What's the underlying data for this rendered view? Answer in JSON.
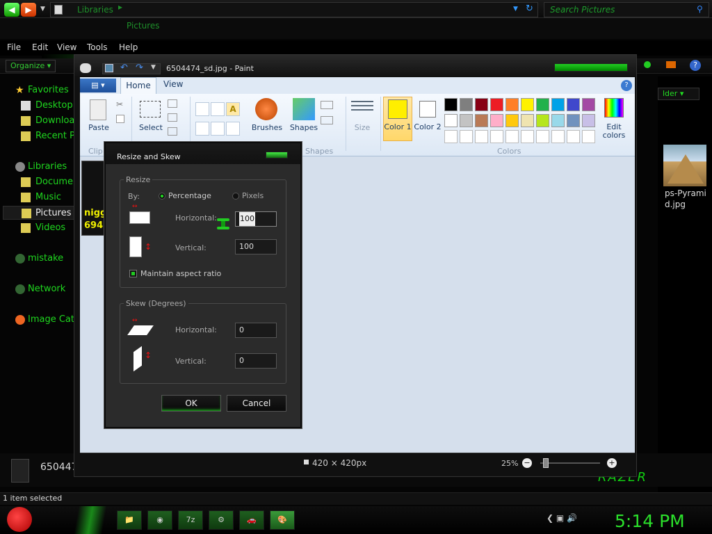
{
  "explorer": {
    "address": {
      "crumb1": "Libraries",
      "crumb2": "Pictures",
      "separator": "▸"
    },
    "search_placeholder": "Search Pictures",
    "menu": [
      "File",
      "Edit",
      "View",
      "Tools",
      "Help"
    ],
    "organize": "Organize ▾",
    "sidebar": [
      {
        "label": "Favorites",
        "icon": "star-icon"
      },
      {
        "label": "Desktop",
        "icon": "desktop-icon"
      },
      {
        "label": "Downloads",
        "icon": "folder-icon"
      },
      {
        "label": "Recent Places",
        "icon": "folder-icon"
      },
      {
        "label": "Libraries",
        "icon": "library-icon"
      },
      {
        "label": "Documents",
        "icon": "folder-icon"
      },
      {
        "label": "Music",
        "icon": "folder-icon"
      },
      {
        "label": "Pictures",
        "icon": "folder-icon"
      },
      {
        "label": "Videos",
        "icon": "folder-icon"
      },
      {
        "label": "mistake",
        "icon": "homegroup-icon"
      },
      {
        "label": "Network",
        "icon": "network-icon"
      },
      {
        "label": "Image Catalog",
        "icon": "catalog-icon"
      }
    ],
    "new_folder": "lder ▾",
    "right_file_label": "ps-Pyrami d.jpg",
    "bottom_file": "650447",
    "status": "1 item selected",
    "brand": "RAZER"
  },
  "taskbar": {
    "buttons": [
      "📁",
      "◉",
      "7z",
      "⚙",
      "🚗",
      "🎨"
    ],
    "tray": "❮  ▣  🔊",
    "clock": "5:14 PM"
  },
  "paint": {
    "title": "6504474_sd.jpg - Paint",
    "tabs": {
      "file": "▤ ▾",
      "home": "Home",
      "view": "View"
    },
    "help": "?",
    "ribbon": {
      "paste": "Paste",
      "clipboard": "Clip",
      "select": "Select",
      "brushes": "Brushes",
      "shapes": "Shapes",
      "shapes_group": "Shapes",
      "size": "Size",
      "color1": "Color 1",
      "color2": "Color 2",
      "edit_colors": "Edit colors",
      "colors_group": "Colors"
    },
    "palette_row1": [
      "#000000",
      "#7f7f7f",
      "#880015",
      "#ed1c24",
      "#ff7f27",
      "#fff200",
      "#22b14c",
      "#00a2e8",
      "#3f48cc",
      "#a349a4"
    ],
    "palette_row2": [
      "#ffffff",
      "#c3c3c3",
      "#b97a57",
      "#ffaec9",
      "#ffc90e",
      "#efe4b0",
      "#b5e61d",
      "#99d9ea",
      "#7092be",
      "#c8bfe7"
    ],
    "canvas_text": [
      "nigg",
      "694"
    ],
    "status": {
      "dimensions": "420 × 420px",
      "zoom": "25%",
      "minus": "−",
      "plus": "+"
    }
  },
  "dialog": {
    "title": "Resize and Skew",
    "resize": {
      "legend": "Resize",
      "by": "By:",
      "percentage": "Percentage",
      "pixels": "Pixels",
      "horizontal_label": "Horizontal:",
      "horizontal_value": "100",
      "vertical_label": "Vertical:",
      "vertical_value": "100",
      "maintain": "Maintain aspect ratio"
    },
    "skew": {
      "legend": "Skew (Degrees)",
      "horizontal_label": "Horizontal:",
      "horizontal_value": "0",
      "vertical_label": "Vertical:",
      "vertical_value": "0"
    },
    "ok": "OK",
    "cancel": "Cancel"
  }
}
